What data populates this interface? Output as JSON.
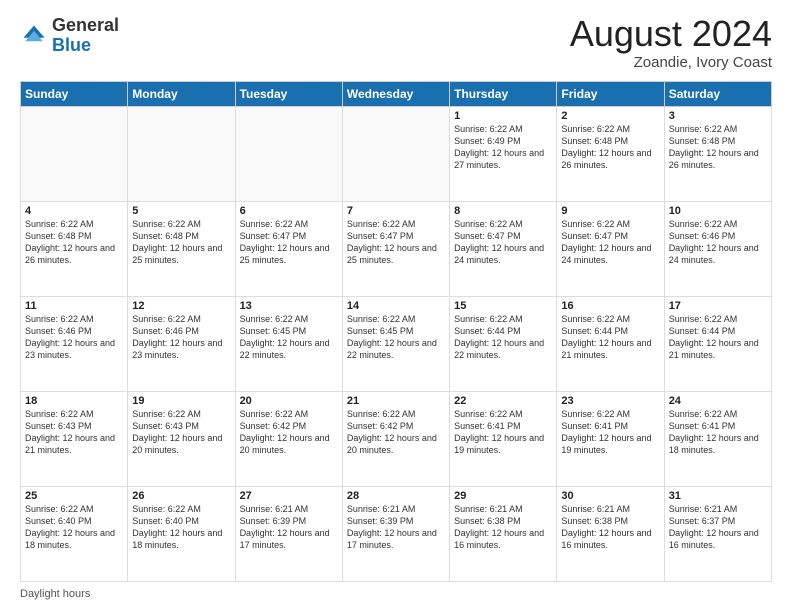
{
  "header": {
    "logo": {
      "general": "General",
      "blue": "Blue"
    },
    "title": "August 2024",
    "subtitle": "Zoandie, Ivory Coast"
  },
  "calendar": {
    "headers": [
      "Sunday",
      "Monday",
      "Tuesday",
      "Wednesday",
      "Thursday",
      "Friday",
      "Saturday"
    ],
    "weeks": [
      [
        {
          "day": "",
          "info": ""
        },
        {
          "day": "",
          "info": ""
        },
        {
          "day": "",
          "info": ""
        },
        {
          "day": "",
          "info": ""
        },
        {
          "day": "1",
          "info": "Sunrise: 6:22 AM\nSunset: 6:49 PM\nDaylight: 12 hours and 27 minutes."
        },
        {
          "day": "2",
          "info": "Sunrise: 6:22 AM\nSunset: 6:48 PM\nDaylight: 12 hours and 26 minutes."
        },
        {
          "day": "3",
          "info": "Sunrise: 6:22 AM\nSunset: 6:48 PM\nDaylight: 12 hours and 26 minutes."
        }
      ],
      [
        {
          "day": "4",
          "info": "Sunrise: 6:22 AM\nSunset: 6:48 PM\nDaylight: 12 hours and 26 minutes."
        },
        {
          "day": "5",
          "info": "Sunrise: 6:22 AM\nSunset: 6:48 PM\nDaylight: 12 hours and 25 minutes."
        },
        {
          "day": "6",
          "info": "Sunrise: 6:22 AM\nSunset: 6:47 PM\nDaylight: 12 hours and 25 minutes."
        },
        {
          "day": "7",
          "info": "Sunrise: 6:22 AM\nSunset: 6:47 PM\nDaylight: 12 hours and 25 minutes."
        },
        {
          "day": "8",
          "info": "Sunrise: 6:22 AM\nSunset: 6:47 PM\nDaylight: 12 hours and 24 minutes."
        },
        {
          "day": "9",
          "info": "Sunrise: 6:22 AM\nSunset: 6:47 PM\nDaylight: 12 hours and 24 minutes."
        },
        {
          "day": "10",
          "info": "Sunrise: 6:22 AM\nSunset: 6:46 PM\nDaylight: 12 hours and 24 minutes."
        }
      ],
      [
        {
          "day": "11",
          "info": "Sunrise: 6:22 AM\nSunset: 6:46 PM\nDaylight: 12 hours and 23 minutes."
        },
        {
          "day": "12",
          "info": "Sunrise: 6:22 AM\nSunset: 6:46 PM\nDaylight: 12 hours and 23 minutes."
        },
        {
          "day": "13",
          "info": "Sunrise: 6:22 AM\nSunset: 6:45 PM\nDaylight: 12 hours and 22 minutes."
        },
        {
          "day": "14",
          "info": "Sunrise: 6:22 AM\nSunset: 6:45 PM\nDaylight: 12 hours and 22 minutes."
        },
        {
          "day": "15",
          "info": "Sunrise: 6:22 AM\nSunset: 6:44 PM\nDaylight: 12 hours and 22 minutes."
        },
        {
          "day": "16",
          "info": "Sunrise: 6:22 AM\nSunset: 6:44 PM\nDaylight: 12 hours and 21 minutes."
        },
        {
          "day": "17",
          "info": "Sunrise: 6:22 AM\nSunset: 6:44 PM\nDaylight: 12 hours and 21 minutes."
        }
      ],
      [
        {
          "day": "18",
          "info": "Sunrise: 6:22 AM\nSunset: 6:43 PM\nDaylight: 12 hours and 21 minutes."
        },
        {
          "day": "19",
          "info": "Sunrise: 6:22 AM\nSunset: 6:43 PM\nDaylight: 12 hours and 20 minutes."
        },
        {
          "day": "20",
          "info": "Sunrise: 6:22 AM\nSunset: 6:42 PM\nDaylight: 12 hours and 20 minutes."
        },
        {
          "day": "21",
          "info": "Sunrise: 6:22 AM\nSunset: 6:42 PM\nDaylight: 12 hours and 20 minutes."
        },
        {
          "day": "22",
          "info": "Sunrise: 6:22 AM\nSunset: 6:41 PM\nDaylight: 12 hours and 19 minutes."
        },
        {
          "day": "23",
          "info": "Sunrise: 6:22 AM\nSunset: 6:41 PM\nDaylight: 12 hours and 19 minutes."
        },
        {
          "day": "24",
          "info": "Sunrise: 6:22 AM\nSunset: 6:41 PM\nDaylight: 12 hours and 18 minutes."
        }
      ],
      [
        {
          "day": "25",
          "info": "Sunrise: 6:22 AM\nSunset: 6:40 PM\nDaylight: 12 hours and 18 minutes."
        },
        {
          "day": "26",
          "info": "Sunrise: 6:22 AM\nSunset: 6:40 PM\nDaylight: 12 hours and 18 minutes."
        },
        {
          "day": "27",
          "info": "Sunrise: 6:21 AM\nSunset: 6:39 PM\nDaylight: 12 hours and 17 minutes."
        },
        {
          "day": "28",
          "info": "Sunrise: 6:21 AM\nSunset: 6:39 PM\nDaylight: 12 hours and 17 minutes."
        },
        {
          "day": "29",
          "info": "Sunrise: 6:21 AM\nSunset: 6:38 PM\nDaylight: 12 hours and 16 minutes."
        },
        {
          "day": "30",
          "info": "Sunrise: 6:21 AM\nSunset: 6:38 PM\nDaylight: 12 hours and 16 minutes."
        },
        {
          "day": "31",
          "info": "Sunrise: 6:21 AM\nSunset: 6:37 PM\nDaylight: 12 hours and 16 minutes."
        }
      ]
    ]
  },
  "footer": {
    "daylight_label": "Daylight hours"
  }
}
